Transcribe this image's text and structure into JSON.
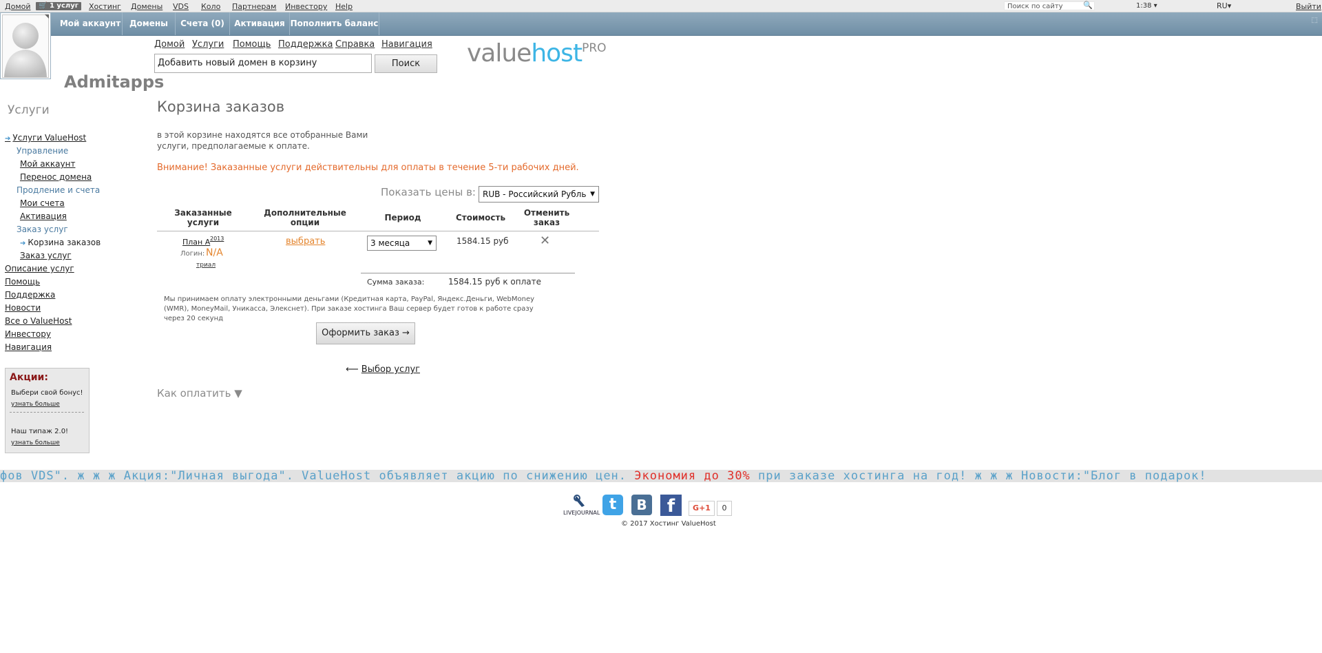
{
  "topbar": {
    "links": [
      "Домой",
      "Хостинг",
      "Домены",
      "VDS",
      "Коло",
      "Партнерам",
      "Инвестору",
      "Help"
    ],
    "cart_badge": "1 услуг",
    "search_placeholder": "Поиск по сайту",
    "time": "1:38",
    "lang": "RU",
    "logout": "Выйти"
  },
  "navbar": {
    "items": [
      "Мой аккаунт",
      "Домены",
      "Счета (0)",
      "Активация",
      "Пополнить баланс"
    ]
  },
  "username": "Admitapps",
  "sublinks": [
    "Домой",
    "Услуги",
    "Помощь",
    "Поддержка",
    "Справка",
    "Навигация"
  ],
  "domain_search": {
    "value": "Добавить новый домен в корзину",
    "button": "Поиск"
  },
  "logo": {
    "value": "value",
    "host": "host",
    "pro": "PRO"
  },
  "sidebar": {
    "title": "Услуги",
    "items": [
      "Услуги ValueHost",
      "Управление",
      "Мой аккаунт",
      "Перенос домена",
      "Продление и счета",
      "Мои счета",
      "Активация",
      "Заказ услуг",
      "Корзина заказов",
      "Заказ услуг",
      "Описание услуг",
      "Помощь",
      "Поддержка",
      "Новости",
      "Все о ValueHost",
      "Инвестору",
      "Навигация"
    ]
  },
  "promo": {
    "title": "Акции:",
    "item1": "Выбери свой бонус!",
    "link1": "узнать больше",
    "item2": "Наш типаж 2.0!",
    "link2": "узнать больше"
  },
  "main": {
    "title": "Корзина заказов",
    "intro": "в этой корзине находятся все отобранные Вами услуги, предполагаемые к оплате.",
    "warning": "Внимание! Заказанные услуги действительны для оплаты в течение 5-ти рабочих дней.",
    "price_label": "Показать цены в:",
    "currency": "RUB - Российский Рубль",
    "headers": [
      "Заказанные услуги",
      "Дополнительные опции",
      "Период",
      "Стоимость",
      "Отменить заказ"
    ],
    "row": {
      "plan": "План А",
      "plan_sup": "2013",
      "login_label": "Логин:",
      "login_value": "N/A",
      "trial": "триал",
      "choose": "выбрать",
      "period": "3 месяца",
      "price": "1584.15 руб"
    },
    "sum_label": "Сумма заказа:",
    "sum_value": "1584.15 руб к оплате",
    "payinfo": "Мы принимаем оплату электронными деньгами (Кредитная карта, PayPal, Яндекс.Деньги, WebMoney (WMR), MoneyMail, Уникасса, Элекснет). При заказе хостинга Ваш сервер будет готов к работе сразу через 20 секунд",
    "order_button": "Оформить заказ  →",
    "back_arrow": "⟵",
    "back": "Выбор услуг",
    "howpay": "Как оплатить ▼"
  },
  "ticker": {
    "part1": "фов VDS\".  ж ж ж  Акция:\"Личная выгода\". ValueHost объявляет акцию по снижению цен. ",
    "red": "Экономия до 30%",
    "part2": " при заказе хостинга на год!  ж ж ж  Новости:\"Блог в подарок!"
  },
  "footer": {
    "livejournal": "LIVEJOURNAL",
    "gplus": "G+1",
    "gcount": "0",
    "copyright": "© 2017 Хостинг ValueHost"
  },
  "colors": {
    "accent_orange": "#e4852e",
    "nav_blue": "#7a97ad",
    "logo_blue": "#3db5e5",
    "ticker_red": "#e0302a"
  }
}
